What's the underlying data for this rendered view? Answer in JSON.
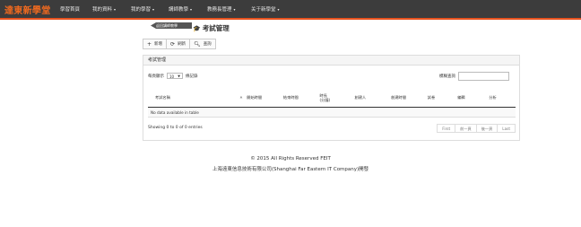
{
  "brand": "達東新學堂",
  "nav": [
    {
      "label": "學習首頁",
      "caret": ""
    },
    {
      "label": "我的資料",
      "caret": "▾"
    },
    {
      "label": "我的學習",
      "caret": "▾"
    },
    {
      "label": "講師教學",
      "caret": "▾"
    },
    {
      "label": "教務長管理",
      "caret": "▾"
    },
    {
      "label": "关于新學堂",
      "caret": "▾"
    }
  ],
  "breadcrumb": "返回講師教學",
  "page_title": "考試管理",
  "icons": {
    "title": "graduation-cap-icon",
    "add": "plus-icon",
    "refresh": "refresh-icon",
    "query": "search-icon"
  },
  "toolbar": {
    "add": "新增",
    "refresh": "刷新",
    "query": "查詢"
  },
  "panel_title": "考試管理",
  "length": {
    "prefix": "每頁顯示",
    "value": "10",
    "suffix": "條記錄"
  },
  "search_label": "模糊查詢",
  "table": {
    "headers": [
      "考試名稱",
      "開始時間",
      "結束時間",
      "時長\n(分鐘)",
      "創建人",
      "創建時間",
      "試卷",
      "編輯",
      "分析"
    ],
    "empty": "No data available in table"
  },
  "info": "Showing 0 to 0 of 0 entries",
  "pagination": [
    "First",
    "前一頁",
    "後一頁",
    "Last"
  ],
  "footer": {
    "copyright": "© 2015 All Rights Reserved FEIT",
    "company": "上海遠東信息技術有限公司(Shanghai Far Eastern IT Company)開發"
  },
  "colors": {
    "navbar": "#3c3c3c",
    "accent": "#e8531f",
    "brand": "#f06a1f"
  }
}
